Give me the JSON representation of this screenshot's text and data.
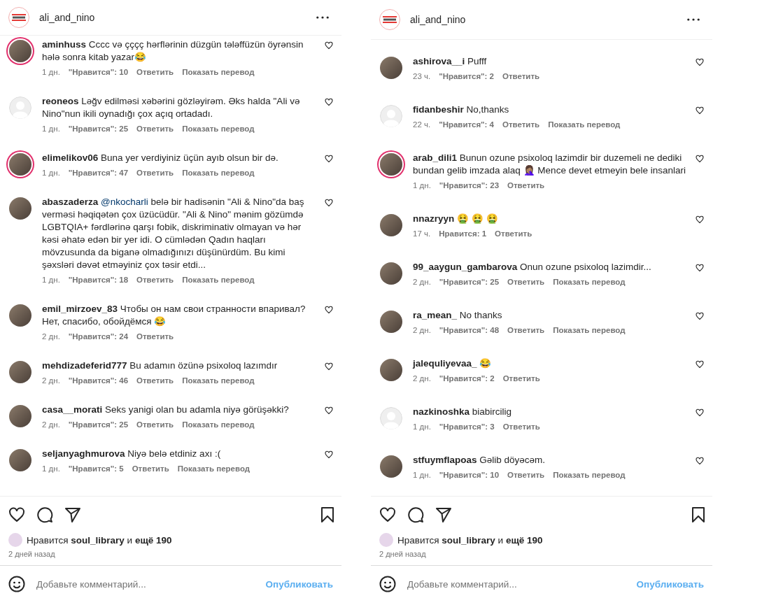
{
  "panels": [
    {
      "header": {
        "username": "ali_and_nino"
      },
      "comments": [
        {
          "username": "aminhuss",
          "text": "Cccc və çççç hərflərinin düzgün tələffüzün öyrənsin hələ sonra kitab yazar😂",
          "kind": "photo",
          "story_ring": true,
          "time": "1 дн.",
          "likes": "\"Нравится\": 10",
          "reply": "Ответить",
          "translate": "Показать перевод"
        },
        {
          "username": "reoneos",
          "text": "Ləğv edilməsi xəbərini gözləyirəm. Əks halda \"Ali və Nino\"nun ikili oynadığı çox açıq ortadadı.",
          "kind": "default",
          "story_ring": false,
          "time": "1 дн.",
          "likes": "\"Нравится\": 25",
          "reply": "Ответить",
          "translate": "Показать перевод"
        },
        {
          "username": "elimelikov06",
          "text": "Buna yer verdiyiniz üçün ayıb olsun bir də.",
          "kind": "photo",
          "story_ring": true,
          "time": "1 дн.",
          "likes": "\"Нравится\": 47",
          "reply": "Ответить",
          "translate": "Показать перевод"
        },
        {
          "username": "abaszaderza",
          "mention": "@nkocharli",
          "text": "belə bir hadisənin \"Ali & Nino\"da baş verməsi həqiqətən çox üzücüdür. \"Ali & Nino\" mənim gözümdə LGBTQIA+ fərdlərinə qarşı fobik, diskriminativ olmayan və hər kəsi əhatə edən bir yer idi. O cümlədən Qadın haqları mövzusunda da biganə olmadığınızı düşünürdüm. Bu kimi şəxsləri dəvət etməyiniz çox təsir etdi...",
          "kind": "photo",
          "story_ring": false,
          "time": "1 дн.",
          "likes": "\"Нравится\": 18",
          "reply": "Ответить",
          "translate": "Показать перевод"
        },
        {
          "username": "emil_mirzoev_83",
          "text": "Чтобы он нам свои странности впаривал? Нет, спасибо, обойдёмся 😂",
          "kind": "photo",
          "story_ring": false,
          "time": "2 дн.",
          "likes": "\"Нравится\": 24",
          "reply": "Ответить"
        },
        {
          "username": "mehdizadeferid777",
          "text": "Bu adamın özünə psixoloq lazımdır",
          "kind": "photo",
          "story_ring": false,
          "time": "2 дн.",
          "likes": "\"Нравится\": 46",
          "reply": "Ответить",
          "translate": "Показать перевод"
        },
        {
          "username": "casa__morati",
          "text": "Seks yanigi olan bu adamla niyə görüşəkki?",
          "kind": "photo",
          "story_ring": false,
          "time": "2 дн.",
          "likes": "\"Нравится\": 25",
          "reply": "Ответить",
          "translate": "Показать перевод"
        },
        {
          "username": "seljanyaghmurova",
          "text": "Niyə belə etdiniz axı :(",
          "kind": "photo",
          "story_ring": false,
          "time": "1 дн.",
          "likes": "\"Нравится\": 5",
          "reply": "Ответить",
          "translate": "Показать перевод"
        }
      ],
      "likes_line": "Нравится **soul_library** и **ещё 190**",
      "date": "2 дней назад",
      "comment_placeholder": "Добавьте комментарий...",
      "post_button": {
        "label": "Опубликовать",
        "disabled": true
      }
    },
    {
      "header": {
        "username": "ali_and_nino"
      },
      "comments": [
        {
          "username": "ashirova__i",
          "text": "Pufff",
          "kind": "photo",
          "story_ring": false,
          "time": "23 ч.",
          "likes": "\"Нравится\": 2",
          "reply": "Ответить"
        },
        {
          "username": "fidanbeshir",
          "text": "No,thanks",
          "kind": "default",
          "story_ring": false,
          "time": "22 ч.",
          "likes": "\"Нравится\": 4",
          "reply": "Ответить",
          "translate": "Показать перевод"
        },
        {
          "username": "arab_dili1",
          "text": "Bunun ozune psixoloq lazimdir bir duzemeli ne dediki bundan gelib imzada alaq 🤦🏽‍♀️ Mence devet etmeyin bele insanlari",
          "kind": "photo",
          "story_ring": true,
          "time": "1 дн.",
          "likes": "\"Нравится\": 23",
          "reply": "Ответить"
        },
        {
          "username": "nnazryyn",
          "text": "🤮 🤮 🤮",
          "kind": "photo",
          "story_ring": false,
          "time": "17 ч.",
          "likes": "Нравится: 1",
          "reply": "Ответить"
        },
        {
          "username": "99_aaygun_gambarova",
          "text": "Onun ozune psixoloq lazimdir...",
          "kind": "photo",
          "story_ring": false,
          "time": "2 дн.",
          "likes": "\"Нравится\": 25",
          "reply": "Ответить",
          "translate": "Показать перевод"
        },
        {
          "username": "ra_mean_",
          "text": "No thanks",
          "kind": "photo",
          "story_ring": false,
          "time": "2 дн.",
          "likes": "\"Нравится\": 48",
          "reply": "Ответить",
          "translate": "Показать перевод"
        },
        {
          "username": "jalequliyevaa_",
          "text": "😂",
          "kind": "photo",
          "story_ring": false,
          "time": "2 дн.",
          "likes": "\"Нравится\": 2",
          "reply": "Ответить"
        },
        {
          "username": "nazkinoshka",
          "text": "biabircilig",
          "kind": "default",
          "story_ring": false,
          "time": "1 дн.",
          "likes": "\"Нравится\": 3",
          "reply": "Ответить"
        },
        {
          "username": "stfuymflapoas",
          "text": "Gəlib döyəcəm.",
          "kind": "photo",
          "story_ring": false,
          "time": "1 дн.",
          "likes": "\"Нравится\": 10",
          "reply": "Ответить",
          "translate": "Показать перевод"
        }
      ],
      "likes_line": "Нравится **soul_library** и **ещё 190**",
      "date": "2 дней назад",
      "comment_placeholder": "Добавьте комментарий...",
      "post_button": {
        "label": "Опубликовать",
        "disabled": true
      }
    }
  ]
}
